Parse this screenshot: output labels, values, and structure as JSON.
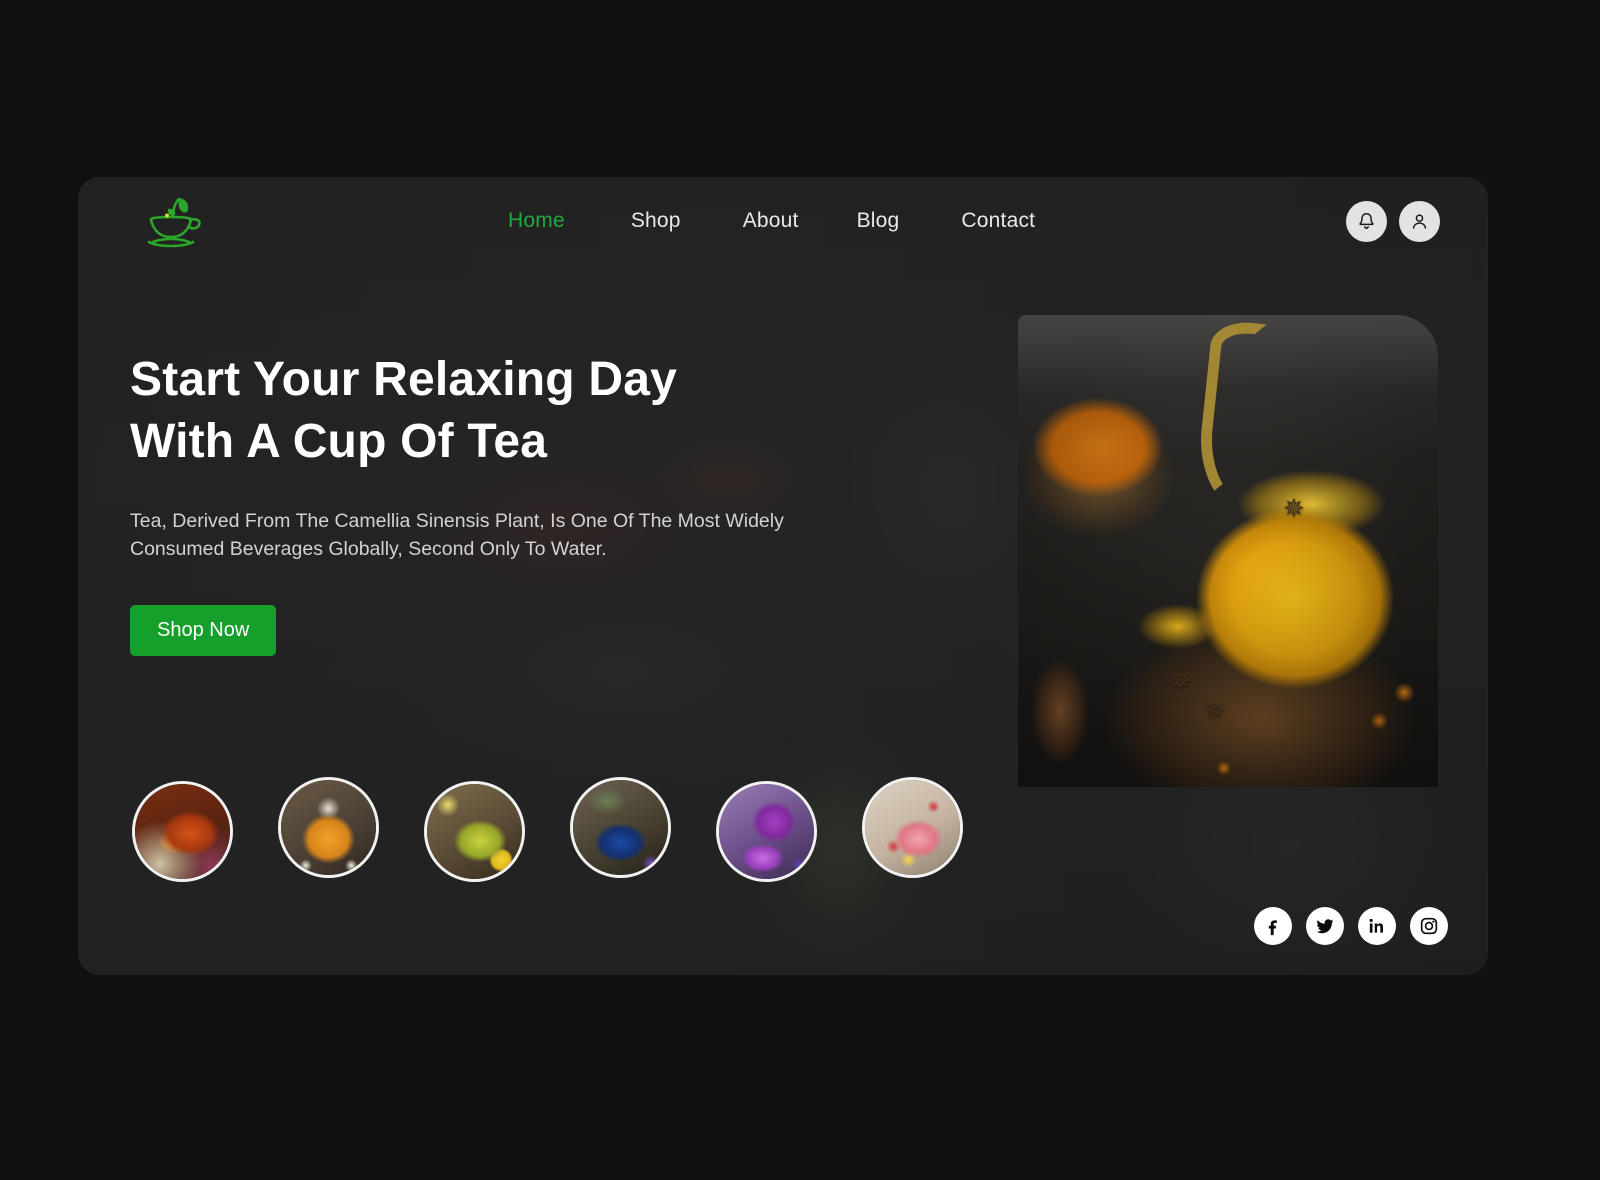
{
  "page": {
    "background_color": "#101010",
    "card_background_color": "#2b2b2b",
    "accent_color": "#14a02b"
  },
  "header": {
    "logo_name": "tea-cup-leaf-logo",
    "logo_color": "#29a329",
    "nav": [
      {
        "label": "Home",
        "active": true
      },
      {
        "label": "Shop",
        "active": false
      },
      {
        "label": "About",
        "active": false
      },
      {
        "label": "Blog",
        "active": false
      },
      {
        "label": "Contact",
        "active": false
      }
    ],
    "actions": [
      {
        "name": "notifications-button",
        "icon": "bell-icon"
      },
      {
        "name": "account-button",
        "icon": "user-icon"
      }
    ]
  },
  "hero": {
    "title_line1": "Start Your Relaxing Day",
    "title_line2": "With A Cup Of Tea",
    "subtitle_line1": "Tea, Derived From The Camellia Sinensis Plant, Is One Of The Most Widely",
    "subtitle_line2": "Consumed Beverages Globally, Second Only To Water.",
    "cta_label": "Shop Now",
    "image_alt": "sea-buckthorn-tea-in-glass-teapot"
  },
  "thumbnails": [
    {
      "name": "thumbnail-black-tea",
      "style": "art-red"
    },
    {
      "name": "thumbnail-chamomile-honey-tea",
      "style": "art-honey"
    },
    {
      "name": "thumbnail-green-lemon-tea",
      "style": "art-green"
    },
    {
      "name": "thumbnail-butterfly-pea-tea",
      "style": "art-blue"
    },
    {
      "name": "thumbnail-purple-floral-tea",
      "style": "art-purple"
    },
    {
      "name": "thumbnail-berry-citrus-tea",
      "style": "art-pink"
    }
  ],
  "social": [
    {
      "name": "facebook-icon",
      "label": "f"
    },
    {
      "name": "twitter-icon",
      "label": "t"
    },
    {
      "name": "linkedin-icon",
      "label": "in"
    },
    {
      "name": "instagram-icon",
      "label": "ig"
    }
  ]
}
